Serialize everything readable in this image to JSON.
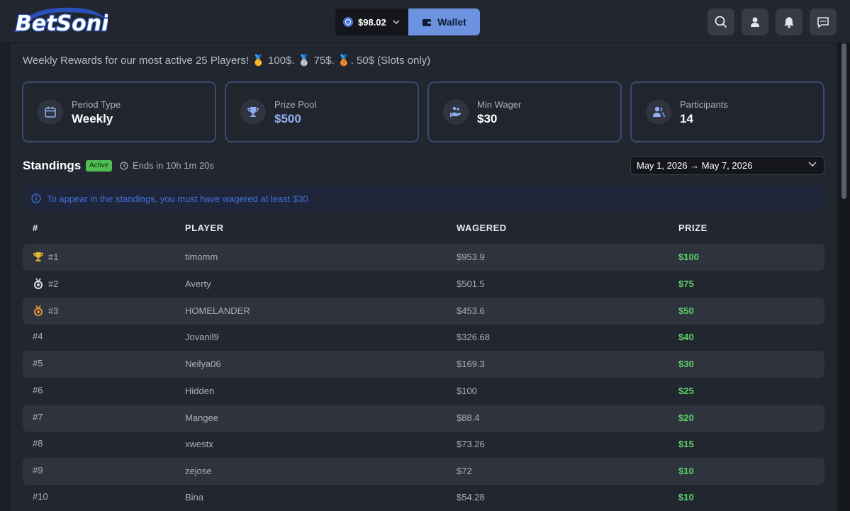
{
  "brand": {
    "name": "BetSonic",
    "accent": "#6d93e0",
    "prize_color": "#5fd16a"
  },
  "header": {
    "balance": "$98.02",
    "wallet_label": "Wallet",
    "icons": [
      "search-icon",
      "user-icon",
      "bell-icon",
      "chat-icon"
    ]
  },
  "intro_text": "Weekly Rewards for our most active 25 Players! 🥇 100$. 🥈 75$. 🥉. 50$ (Slots only)",
  "stats": [
    {
      "label": "Period Type",
      "value": "Weekly",
      "icon": "calendar-icon"
    },
    {
      "label": "Prize Pool",
      "value": "$500",
      "icon": "trophy-icon"
    },
    {
      "label": "Min Wager",
      "value": "$30",
      "icon": "wager-hand-icon"
    },
    {
      "label": "Participants",
      "value": "14",
      "icon": "participants-icon"
    }
  ],
  "standings": {
    "title": "Standings",
    "status_badge": "Active",
    "ends_text": "Ends in 10h 1m 20s",
    "date_range": "May 1, 2026 → May 7, 2026",
    "notice": "To appear in the standings, you must have wagered at least $30",
    "columns": {
      "rank": "#",
      "player": "PLAYER",
      "wagered": "WAGERED",
      "prize": "PRIZE"
    },
    "rows": [
      {
        "rank": "#1",
        "player": "timomm",
        "wagered": "$953.9",
        "prize": "$100",
        "medal": "trophy-icon"
      },
      {
        "rank": "#2",
        "player": "Averty",
        "wagered": "$501.5",
        "prize": "$75",
        "medal": "silver-medal-icon"
      },
      {
        "rank": "#3",
        "player": "HOMELANDER",
        "wagered": "$453.6",
        "prize": "$50",
        "medal": "bronze-medal-icon"
      },
      {
        "rank": "#4",
        "player": "Jovanil9",
        "wagered": "$326.68",
        "prize": "$40"
      },
      {
        "rank": "#5",
        "player": "Neilya06",
        "wagered": "$169.3",
        "prize": "$30"
      },
      {
        "rank": "#6",
        "player": "Hidden",
        "wagered": "$100",
        "prize": "$25"
      },
      {
        "rank": "#7",
        "player": "Mangee",
        "wagered": "$88.4",
        "prize": "$20"
      },
      {
        "rank": "#8",
        "player": "xwestx",
        "wagered": "$73.26",
        "prize": "$15"
      },
      {
        "rank": "#9",
        "player": "zejose",
        "wagered": "$72",
        "prize": "$10"
      },
      {
        "rank": "#10",
        "player": "Bina",
        "wagered": "$54.28",
        "prize": "$10"
      }
    ]
  }
}
